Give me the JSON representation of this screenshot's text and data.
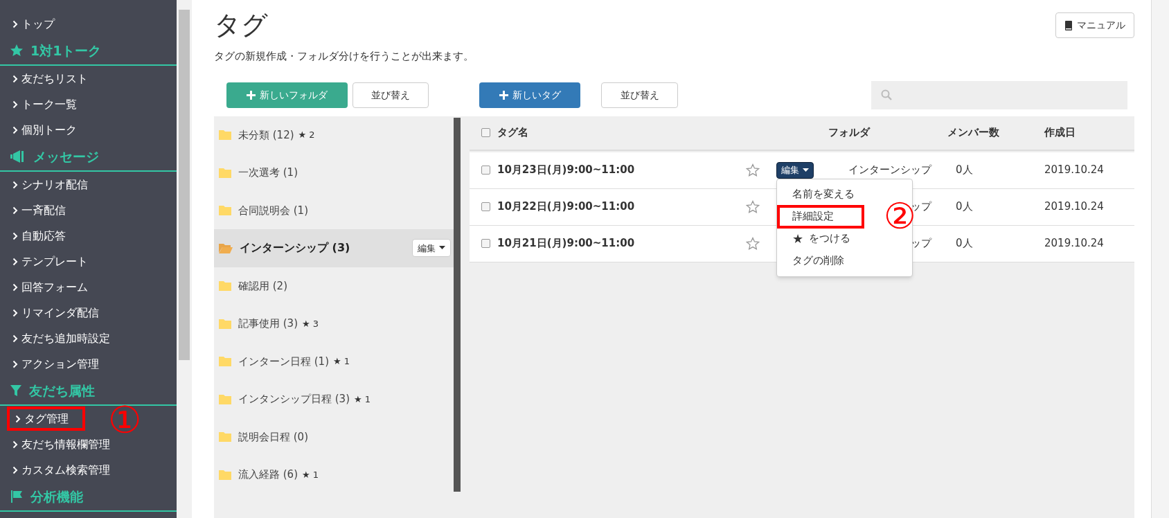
{
  "sidebar": {
    "items": [
      {
        "kind": "link",
        "label": "トップ"
      },
      {
        "kind": "section",
        "label": "1対1トーク"
      },
      {
        "kind": "link",
        "label": "友だちリスト"
      },
      {
        "kind": "link",
        "label": "トーク一覧"
      },
      {
        "kind": "link",
        "label": "個別トーク"
      },
      {
        "kind": "section",
        "label": "メッセージ"
      },
      {
        "kind": "link",
        "label": "シナリオ配信"
      },
      {
        "kind": "link",
        "label": "一斉配信"
      },
      {
        "kind": "link",
        "label": "自動応答"
      },
      {
        "kind": "link",
        "label": "テンプレート"
      },
      {
        "kind": "link",
        "label": "回答フォーム"
      },
      {
        "kind": "link",
        "label": "リマインダ配信"
      },
      {
        "kind": "link",
        "label": "友だち追加時設定"
      },
      {
        "kind": "link",
        "label": "アクション管理"
      },
      {
        "kind": "section",
        "label": "友だち属性"
      },
      {
        "kind": "link",
        "label": "タグ管理",
        "callout": "①"
      },
      {
        "kind": "link",
        "label": "友だち情報欄管理"
      },
      {
        "kind": "link",
        "label": "カスタム検索管理"
      },
      {
        "kind": "section",
        "label": "分析機能"
      }
    ]
  },
  "page": {
    "title": "タグ",
    "description": "タグの新規作成・フォルダ分けを行うことが出来ます。",
    "manual_button": "マニュアル"
  },
  "toolbar": {
    "new_folder": "新しいフォルダ",
    "folder_sort": "並び替え",
    "new_tag": "新しいタグ",
    "tag_sort": "並び替え"
  },
  "folders": [
    {
      "label": "未分類 (12)",
      "star_badge": "★ 2",
      "selected": false
    },
    {
      "label": "一次選考 (1)",
      "selected": false
    },
    {
      "label": "合同説明会 (1)",
      "selected": false
    },
    {
      "label": "インターンシップ (3)",
      "selected": true,
      "edit_label": "編集"
    },
    {
      "label": "確認用 (2)",
      "selected": false
    },
    {
      "label": "記事使用 (3)",
      "star_badge": "★ 3",
      "selected": false
    },
    {
      "label": "インターン日程 (1)",
      "star_badge": "★ 1",
      "selected": false
    },
    {
      "label": "インタンシップ日程 (3)",
      "star_badge": "★ 1",
      "selected": false
    },
    {
      "label": "説明会日程 (0)",
      "selected": false
    },
    {
      "label": "流入経路 (6)",
      "star_badge": "★ 1",
      "selected": false
    }
  ],
  "table": {
    "columns": [
      "タグ名",
      "フォルダ",
      "メンバー数",
      "作成日"
    ],
    "header_checked": false,
    "rows": [
      {
        "checked": false,
        "name": "10月23日(月)9:00~11:00",
        "edit_label": "編集",
        "folder": "インターンシップ",
        "members": "0人",
        "created": "2019.10.24"
      },
      {
        "checked": false,
        "name": "10月22日(月)9:00~11:00",
        "folder": "ップ",
        "members": "0人",
        "created": "2019.10.24"
      },
      {
        "checked": false,
        "name": "10月21日(月)9:00~11:00",
        "folder": "ップ",
        "members": "0人",
        "created": "2019.10.24"
      }
    ]
  },
  "edit_menu": {
    "items": [
      {
        "label": "名前を変える"
      },
      {
        "label": "詳細設定",
        "callout": "②"
      },
      {
        "label": "をつける",
        "star": "★"
      },
      {
        "label": "タグの削除"
      }
    ]
  }
}
